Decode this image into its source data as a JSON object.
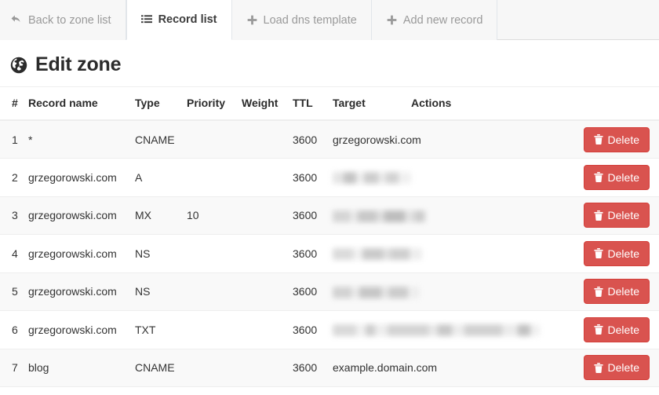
{
  "tabs": [
    {
      "id": "back-to-zone-list",
      "label": "Back to zone list",
      "icon": "undo-arrow-icon",
      "active": false
    },
    {
      "id": "record-list",
      "label": "Record list",
      "icon": "list-icon",
      "active": true
    },
    {
      "id": "load-dns-template",
      "label": "Load dns template",
      "icon": "plus-icon",
      "active": false
    },
    {
      "id": "add-new-record",
      "label": "Add new record",
      "icon": "plus-icon",
      "active": false
    }
  ],
  "page": {
    "title": "Edit zone",
    "title_icon": "globe-icon"
  },
  "table": {
    "headers": {
      "index": "#",
      "record_name": "Record name",
      "type": "Type",
      "priority": "Priority",
      "weight": "Weight",
      "ttl": "TTL",
      "target": "Target",
      "actions": "Actions"
    },
    "delete_label": "Delete",
    "rows": [
      {
        "index": "1",
        "record_name": "*",
        "type": "CNAME",
        "priority": "",
        "weight": "",
        "ttl": "3600",
        "target": "grzegorowski.com",
        "target_redacted": false,
        "redact_class": ""
      },
      {
        "index": "2",
        "record_name": "grzegorowski.com",
        "type": "A",
        "priority": "",
        "weight": "",
        "ttl": "3600",
        "target": "",
        "target_redacted": true,
        "redact_class": "r-ip"
      },
      {
        "index": "3",
        "record_name": "grzegorowski.com",
        "type": "MX",
        "priority": "10",
        "weight": "",
        "ttl": "3600",
        "target": "",
        "target_redacted": true,
        "redact_class": "r-mx"
      },
      {
        "index": "4",
        "record_name": "grzegorowski.com",
        "type": "NS",
        "priority": "",
        "weight": "",
        "ttl": "3600",
        "target": "",
        "target_redacted": true,
        "redact_class": "r-ns1"
      },
      {
        "index": "5",
        "record_name": "grzegorowski.com",
        "type": "NS",
        "priority": "",
        "weight": "",
        "ttl": "3600",
        "target": "",
        "target_redacted": true,
        "redact_class": "r-ns2"
      },
      {
        "index": "6",
        "record_name": "grzegorowski.com",
        "type": "TXT",
        "priority": "",
        "weight": "",
        "ttl": "3600",
        "target": "",
        "target_redacted": true,
        "redact_class": "r-txt"
      },
      {
        "index": "7",
        "record_name": "blog",
        "type": "CNAME",
        "priority": "",
        "weight": "",
        "ttl": "3600",
        "target": "example.domain.com",
        "target_redacted": false,
        "redact_class": ""
      }
    ]
  },
  "colors": {
    "danger": "#d9534f",
    "danger_border": "#d43f3a",
    "tab_bar_bg": "#f7f7f7",
    "stripe": "#f9f9f9",
    "border": "#dddddd",
    "text": "#333333",
    "muted_text": "#999999"
  }
}
